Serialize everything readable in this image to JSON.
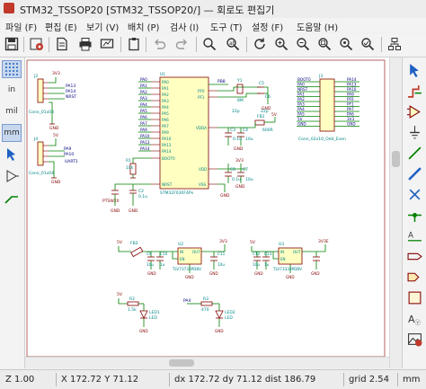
{
  "window": {
    "title": "STM32_TSSOP20 [STM32_TSSOP20/] — 회로도 편집기"
  },
  "menu": [
    "파일 (F)",
    "편집 (E)",
    "보기 (V)",
    "배치 (P)",
    "검사 (I)",
    "도구 (T)",
    "설정 (F)",
    "도움말 (H)"
  ],
  "left_toolbar": {
    "grid": "grid-icon",
    "in": "in",
    "mil": "mil",
    "mm": "mm",
    "active_unit": "mm"
  },
  "schematic": {
    "u1": {
      "ref": "U1",
      "value": "STM32F030F4Px",
      "left_pins": [
        "PA0",
        "PA1",
        "PA2",
        "PA3",
        "PA4",
        "PA5",
        "PA6",
        "PA7",
        "PA9",
        "PA10",
        "PA13",
        "PA14",
        "BOOT0",
        "NRST"
      ],
      "right_pins": [
        "PF0",
        "PF1",
        "VDDA",
        "VDD",
        "VSS"
      ]
    },
    "j2": {
      "ref": "J2",
      "value": "Conn_01x04",
      "pins": [
        "3V3",
        "PA13",
        "PA14",
        "NRST"
      ],
      "gnd": "GND"
    },
    "j4": {
      "ref": "J4",
      "value": "Conn_01x04",
      "pins": [
        "5V",
        "PA9",
        "PA10"
      ],
      "gnd": "GND"
    },
    "net_labels": [
      "PA10",
      "PA9",
      "UART1",
      "SWD",
      "PA13",
      "PA14",
      "PB8",
      "PF0",
      "PF1"
    ],
    "j3": {
      "ref": "J3",
      "value": "Conn_02x10_Odd_Even",
      "left": [
        "BOOT0",
        "PA0",
        "NRST",
        "PA1",
        "PA2",
        "PA3",
        "PA4",
        "PA5",
        "5V",
        "GND"
      ],
      "right": [
        "PA14",
        "PA13",
        "PA10",
        "PA9",
        "PF0",
        "PF1",
        "PA7",
        "PA6",
        "3V3",
        "GND"
      ]
    },
    "reset_parts": {
      "r1": "R1",
      "r1v": "10k",
      "sw": "PTSW20",
      "c2": "C2",
      "c2v": "0.1u"
    },
    "decoupling": {
      "c3": "C3",
      "c3v": "0.1u",
      "c4": "C4",
      "c4v": "10u",
      "c8": "C8",
      "c8v": "0.1u",
      "c7": "C7",
      "c7v": "10u",
      "fb1": "FB1",
      "fb1v": "600R"
    },
    "xtal": {
      "y1": "Y1",
      "y1v": "8M",
      "c5": "C5",
      "c5v": "22p",
      "c6": "C6",
      "c6v": "22p"
    },
    "gnd": "GND",
    "vdda_net": "VDDA",
    "reg1": {
      "ref": "U2",
      "part": "TLV73733PDBV",
      "in": "5V",
      "out": "3V3",
      "fb": "FB2",
      "cin": "C9",
      "cinv": "10u",
      "cout": "C10",
      "coutv": "1u",
      "extra": "C11",
      "extrav": "10u",
      "pins_l": "IN",
      "pins_r": "OUT",
      "en": "EN"
    },
    "reg2": {
      "ref": "U3",
      "part": "TLV73333PDBV",
      "in": "5V",
      "out": "3V3E",
      "cin": "C12",
      "cinv": "10u",
      "cout": "C13",
      "coutv": "1u",
      "pins_l": "IN",
      "pins_r": "OUT",
      "en": "EN"
    },
    "leds": {
      "v1": "5V",
      "r2": "R2",
      "r2v": "1.5k",
      "d1": "LED1",
      "d1v": "LED",
      "r3": "R3",
      "r3v": "470",
      "d2": "LED2",
      "d2v": "LED",
      "net": "PA4"
    }
  },
  "status": {
    "zoom": "Z 1.00",
    "xy": "X 172.72  Y 71.12",
    "delta": "dx 172.72  dy 71.12  dist 186.79",
    "grid": "grid 2.54",
    "unit": "mm"
  },
  "colors": {
    "wire": "#008000",
    "body": "#840000",
    "label": "#000080",
    "pin": "#840000",
    "accent": "#1e61c2"
  }
}
